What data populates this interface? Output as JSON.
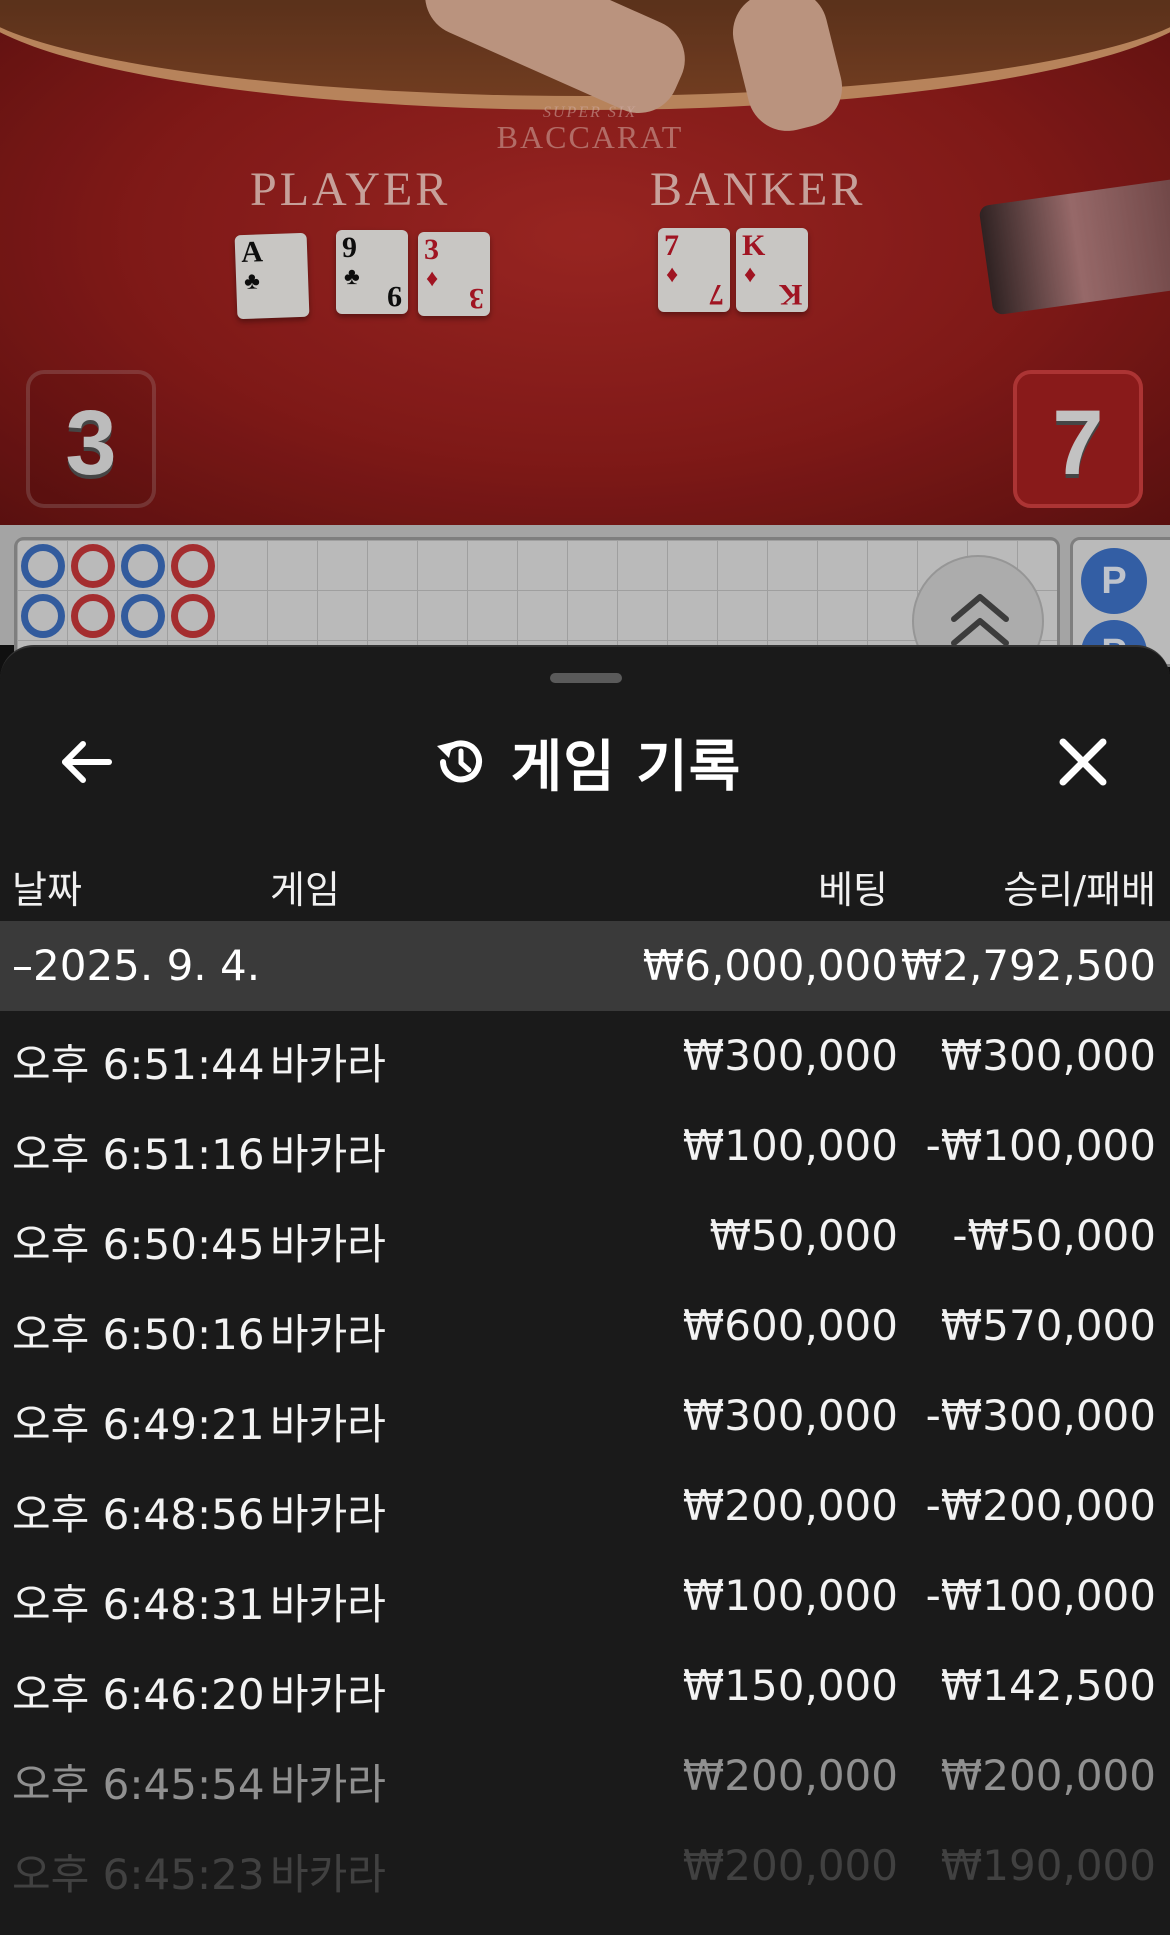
{
  "table": {
    "brand_line1": "SUPER SIX",
    "brand_line2": "BACCARAT",
    "player_label": "PLAYER",
    "banker_label": "BANKER",
    "player_cards": [
      {
        "rank": "A",
        "suit": "♣",
        "color": "black"
      },
      {
        "rank": "9",
        "suit": "♣",
        "color": "black"
      },
      {
        "rank": "3",
        "suit": "♦",
        "color": "red"
      }
    ],
    "banker_cards": [
      {
        "rank": "7",
        "suit": "♦",
        "color": "red"
      },
      {
        "rank": "K",
        "suit": "♦",
        "color": "red"
      }
    ],
    "player_score": "3",
    "banker_score": "7"
  },
  "road": {
    "badge_label": "P",
    "beads": [
      [
        "blue",
        "red",
        "blue",
        "red"
      ],
      [
        "blue",
        "red",
        "blue",
        "red"
      ]
    ],
    "expand_icon": "double-chevron-up-icon"
  },
  "sheet": {
    "title": "게임 기록",
    "title_icon": "history-icon",
    "back_icon": "arrow-left-icon",
    "close_icon": "close-icon",
    "columns": {
      "date": "날짜",
      "game": "게임",
      "bet": "베팅",
      "result": "승리/패배"
    },
    "date_group": {
      "date": "–2025. 9. 4.",
      "bet_total": "₩6,000,000",
      "result_total": "₩2,792,500"
    },
    "rows": [
      {
        "time": "오후 6:51:44",
        "game": "바카라",
        "bet": "₩300,000",
        "result": "₩300,000"
      },
      {
        "time": "오후 6:51:16",
        "game": "바카라",
        "bet": "₩100,000",
        "result": "-₩100,000"
      },
      {
        "time": "오후 6:50:45",
        "game": "바카라",
        "bet": "₩50,000",
        "result": "-₩50,000"
      },
      {
        "time": "오후 6:50:16",
        "game": "바카라",
        "bet": "₩600,000",
        "result": "₩570,000"
      },
      {
        "time": "오후 6:49:21",
        "game": "바카라",
        "bet": "₩300,000",
        "result": "-₩300,000"
      },
      {
        "time": "오후 6:48:56",
        "game": "바카라",
        "bet": "₩200,000",
        "result": "-₩200,000"
      },
      {
        "time": "오후 6:48:31",
        "game": "바카라",
        "bet": "₩100,000",
        "result": "-₩100,000"
      },
      {
        "time": "오후 6:46:20",
        "game": "바카라",
        "bet": "₩150,000",
        "result": "₩142,500"
      },
      {
        "time": "오후 6:45:54",
        "game": "바카라",
        "bet": "₩200,000",
        "result": "₩200,000"
      },
      {
        "time": "오후 6:45:23",
        "game": "바카라",
        "bet": "₩200,000",
        "result": "₩190,000"
      }
    ]
  },
  "colors": {
    "sheet_bg": "#1a1a1a",
    "date_row_bg": "#3a3a3a",
    "felt": "#9b1f1d",
    "player_blue": "#3d6fc0",
    "banker_red": "#c9373a"
  }
}
